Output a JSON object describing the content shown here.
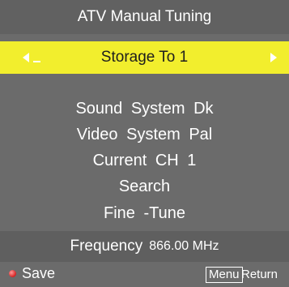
{
  "header": {
    "title": "ATV Manual Tuning"
  },
  "selected_item": {
    "label": "Storage To 1"
  },
  "menu_items": [
    "Sound  System  Dk",
    "Video  System  Pal",
    "Current CH 1",
    "Search",
    "Fine -Tune"
  ],
  "frequency": {
    "label": "Frequency",
    "value": "866.00 MHz"
  },
  "footer": {
    "save_label": "Save",
    "menu_key": "Menu",
    "return_label": "Return"
  },
  "colors": {
    "background": "#6b6b6b",
    "highlight": "#f2ee2d",
    "text": "#ffffff",
    "selected_text": "#1e1e1e",
    "save_dot": "#d42020"
  }
}
